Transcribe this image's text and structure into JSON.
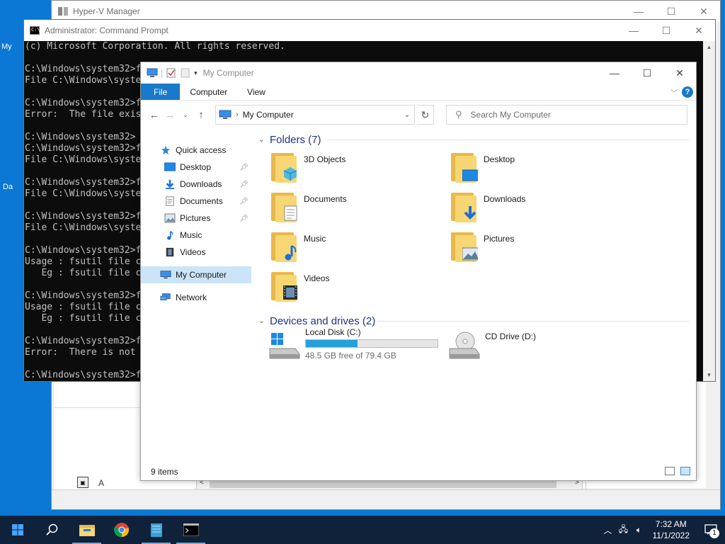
{
  "desktop": {
    "icon_label_1": "My",
    "icon_label_2": "Da"
  },
  "hyperv": {
    "title": "Hyper-V Manager",
    "lower_label": "A"
  },
  "cmd": {
    "title": "Administrator: Command Prompt",
    "lines": [
      "(c) Microsoft Corporation. All rights reserved.",
      "",
      "C:\\Windows\\system32>f",
      "File C:\\Windows\\syste",
      "",
      "C:\\Windows\\system32>f",
      "Error:  The file exis",
      "",
      "C:\\Windows\\system32>",
      "C:\\Windows\\system32>f",
      "File C:\\Windows\\syste",
      "",
      "C:\\Windows\\system32>f",
      "File C:\\Windows\\syste",
      "",
      "C:\\Windows\\system32>f",
      "File C:\\Windows\\syste",
      "",
      "C:\\Windows\\system32>f",
      "Usage : fsutil file c",
      "   Eg : fsutil file c",
      "",
      "C:\\Windows\\system32>f",
      "Usage : fsutil file c",
      "   Eg : fsutil file c",
      "",
      "C:\\Windows\\system32>f",
      "Error:  There is not",
      "",
      "C:\\Windows\\system32>f"
    ]
  },
  "explorer": {
    "title": "My Computer",
    "ribbon": {
      "file": "File",
      "computer": "Computer",
      "view": "View",
      "help": "?"
    },
    "address": "My Computer",
    "search_placeholder": "Search My Computer",
    "nav": {
      "quick_access": "Quick access",
      "desktop": "Desktop",
      "downloads": "Downloads",
      "documents": "Documents",
      "pictures": "Pictures",
      "music": "Music",
      "videos": "Videos",
      "my_computer": "My Computer",
      "network": "Network"
    },
    "folders_header": "Folders (7)",
    "folders": [
      "3D Objects",
      "Desktop",
      "Documents",
      "Downloads",
      "Music",
      "Pictures",
      "Videos"
    ],
    "devices_header": "Devices and drives (2)",
    "drive_c": {
      "name": "Local Disk (C:)",
      "free": "48.5 GB free of 79.4 GB",
      "used_fraction": 0.39
    },
    "drive_d": {
      "name": "CD Drive (D:)"
    },
    "status": "9 items"
  },
  "taskbar": {
    "time": "7:32 AM",
    "date": "11/1/2022",
    "notifications": "1"
  },
  "colors": {
    "accent": "#1979ca",
    "desktop": "#0a78d4",
    "taskbar": "#10213a"
  }
}
